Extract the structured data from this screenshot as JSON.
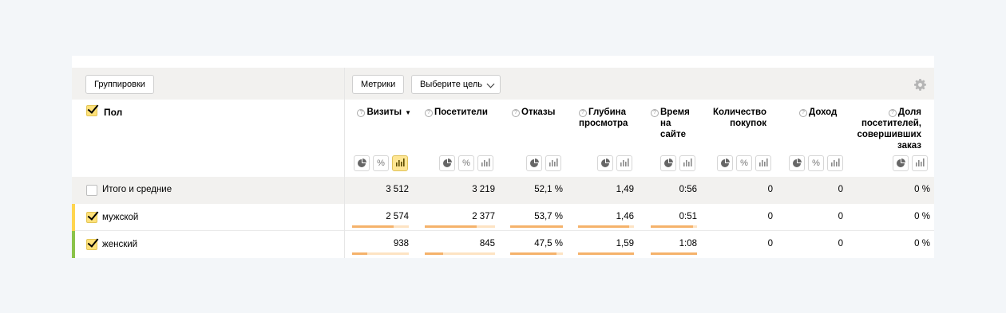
{
  "toolbar": {
    "groupings_label": "Группировки",
    "metrics_label": "Метрики",
    "goal_label": "Выберите цель"
  },
  "dimension": {
    "title": "Пол"
  },
  "metrics": [
    {
      "label": "Визиты",
      "sort": "▼"
    },
    {
      "label": "Посетители"
    },
    {
      "label": "Отказы"
    },
    {
      "label1": "Глубина",
      "label2": "просмотра"
    },
    {
      "label1": "Время",
      "label2": "на сайте"
    },
    {
      "label1": "Количество",
      "label2": "покупок"
    },
    {
      "label": "Доход"
    },
    {
      "label1": "Доля",
      "label2": "посетителей,",
      "label3": "совершивших",
      "label4": "заказ"
    }
  ],
  "view_icons": {
    "pie": "pie-icon",
    "percent": "%",
    "bar": "bar-chart-icon"
  },
  "rows": {
    "total": {
      "label": "Итого и средние",
      "values": [
        "3 512",
        "3 219",
        "52,1 %",
        "1,49",
        "0:56",
        "0",
        "0",
        "0 %"
      ]
    },
    "male": {
      "label": "мужской",
      "values": [
        "2 574",
        "2 377",
        "53,7 %",
        "1,46",
        "0:51",
        "0",
        "0",
        "0 %"
      ],
      "bar_fractions": [
        0.733,
        0.738,
        1.0,
        0.918,
        0.91
      ]
    },
    "female": {
      "label": "женский",
      "values": [
        "938",
        "845",
        "47,5 %",
        "1,59",
        "1:08",
        "0",
        "0",
        "0 %"
      ],
      "bar_fractions": [
        0.267,
        0.262,
        0.885,
        1.0,
        1.0
      ]
    }
  },
  "colors": {
    "male": "#ffd54f",
    "female": "#8bc34a",
    "accent": "#ffe17a",
    "bar": "#f5b26b"
  }
}
